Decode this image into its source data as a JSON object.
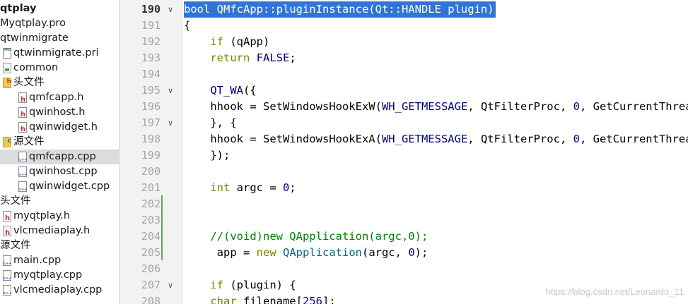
{
  "project_tree": {
    "items": [
      {
        "label": "qtplay",
        "icon": "none",
        "indent": 0,
        "bold": true
      },
      {
        "label": "Myqtplay.pro",
        "icon": "none",
        "indent": 0
      },
      {
        "label": "qtwinmigrate",
        "icon": "none",
        "indent": 0
      },
      {
        "label": "qtwinmigrate.pri",
        "icon": "pro-file-icon",
        "indent": 1
      },
      {
        "label": "common",
        "icon": "qt-folder-icon",
        "indent": 1
      },
      {
        "label": "头文件",
        "icon": "header-folder-icon",
        "indent": 1
      },
      {
        "label": "qmfcapp.h",
        "icon": "header-file-icon",
        "indent": 2
      },
      {
        "label": "qwinhost.h",
        "icon": "header-file-icon",
        "indent": 2
      },
      {
        "label": "qwinwidget.h",
        "icon": "header-file-icon",
        "indent": 2
      },
      {
        "label": "源文件",
        "icon": "source-folder-icon",
        "indent": 1
      },
      {
        "label": "qmfcapp.cpp",
        "icon": "cpp-file-icon",
        "indent": 2,
        "selected": true
      },
      {
        "label": "qwinhost.cpp",
        "icon": "cpp-file-icon",
        "indent": 2
      },
      {
        "label": "qwinwidget.cpp",
        "icon": "cpp-file-icon",
        "indent": 2
      },
      {
        "label": "头文件",
        "icon": "none",
        "indent": 0
      },
      {
        "label": "myqtplay.h",
        "icon": "header-file-icon",
        "indent": 1
      },
      {
        "label": "vlcmediaplay.h",
        "icon": "header-file-icon",
        "indent": 1
      },
      {
        "label": "源文件",
        "icon": "none",
        "indent": 0
      },
      {
        "label": "main.cpp",
        "icon": "cpp-file-icon",
        "indent": 1
      },
      {
        "label": "myqtplay.cpp",
        "icon": "cpp-file-icon",
        "indent": 1
      },
      {
        "label": "vlcmediaplay.cpp",
        "icon": "cpp-file-icon",
        "indent": 1
      }
    ]
  },
  "editor": {
    "lines": [
      {
        "num": "190",
        "fold": true,
        "current": true,
        "selected": true,
        "tokens": [
          {
            "t": "bool QMfcApp::pluginInstance(Qt::HANDLE plugin)",
            "c": ""
          }
        ]
      },
      {
        "num": "191",
        "tokens": [
          {
            "t": "{",
            "c": ""
          }
        ]
      },
      {
        "num": "192",
        "tokens": [
          {
            "t": "    ",
            "c": ""
          },
          {
            "t": "if",
            "c": "kw"
          },
          {
            "t": " (qApp)",
            "c": ""
          }
        ]
      },
      {
        "num": "193",
        "tokens": [
          {
            "t": "    ",
            "c": ""
          },
          {
            "t": "return",
            "c": "kw"
          },
          {
            "t": " ",
            "c": ""
          },
          {
            "t": "FALSE",
            "c": "const"
          },
          {
            "t": ";",
            "c": ""
          }
        ]
      },
      {
        "num": "194",
        "tokens": []
      },
      {
        "num": "195",
        "fold": true,
        "tokens": [
          {
            "t": "    ",
            "c": ""
          },
          {
            "t": "QT_WA",
            "c": "const"
          },
          {
            "t": "({",
            "c": ""
          }
        ]
      },
      {
        "num": "196",
        "tokens": [
          {
            "t": "    hhook = SetWindowsHookExW(",
            "c": ""
          },
          {
            "t": "WH_GETMESSAGE",
            "c": "const"
          },
          {
            "t": ", QtFilterProc, ",
            "c": ""
          },
          {
            "t": "0",
            "c": "num"
          },
          {
            "t": ", GetCurrentThreadId());",
            "c": ""
          }
        ]
      },
      {
        "num": "197",
        "fold": true,
        "tokens": [
          {
            "t": "    }, {",
            "c": ""
          }
        ]
      },
      {
        "num": "198",
        "tokens": [
          {
            "t": "    hhook = SetWindowsHookExA(",
            "c": ""
          },
          {
            "t": "WH_GETMESSAGE",
            "c": "const"
          },
          {
            "t": ", QtFilterProc, ",
            "c": ""
          },
          {
            "t": "0",
            "c": "num"
          },
          {
            "t": ", GetCurrentThreadId());",
            "c": ""
          }
        ]
      },
      {
        "num": "199",
        "tokens": [
          {
            "t": "    });",
            "c": ""
          }
        ]
      },
      {
        "num": "200",
        "tokens": []
      },
      {
        "num": "201",
        "tokens": [
          {
            "t": "    ",
            "c": ""
          },
          {
            "t": "int",
            "c": "kw"
          },
          {
            "t": " argc = ",
            "c": ""
          },
          {
            "t": "0",
            "c": "num"
          },
          {
            "t": ";",
            "c": ""
          }
        ]
      },
      {
        "num": "202",
        "tokens": []
      },
      {
        "num": "203",
        "tokens": []
      },
      {
        "num": "204",
        "tokens": [
          {
            "t": "    //(void)new QApplication(argc,0);",
            "c": "cmt"
          }
        ]
      },
      {
        "num": "205",
        "tokens": [
          {
            "t": "     app = ",
            "c": ""
          },
          {
            "t": "new",
            "c": "kw"
          },
          {
            "t": " ",
            "c": ""
          },
          {
            "t": "QApplication",
            "c": "fn"
          },
          {
            "t": "(argc, ",
            "c": ""
          },
          {
            "t": "0",
            "c": "num"
          },
          {
            "t": ");",
            "c": ""
          }
        ]
      },
      {
        "num": "206",
        "tokens": []
      },
      {
        "num": "207",
        "fold": true,
        "tokens": [
          {
            "t": "    ",
            "c": ""
          },
          {
            "t": "if",
            "c": "kw"
          },
          {
            "t": " (plugin) {",
            "c": ""
          }
        ]
      },
      {
        "num": "208",
        "tokens": [
          {
            "t": "    ",
            "c": ""
          },
          {
            "t": "char",
            "c": "kw"
          },
          {
            "t": " filename[",
            "c": ""
          },
          {
            "t": "256",
            "c": "num"
          },
          {
            "t": "];",
            "c": ""
          }
        ]
      }
    ]
  },
  "watermark": "https://blog.csdn.net/Leonardo_11"
}
